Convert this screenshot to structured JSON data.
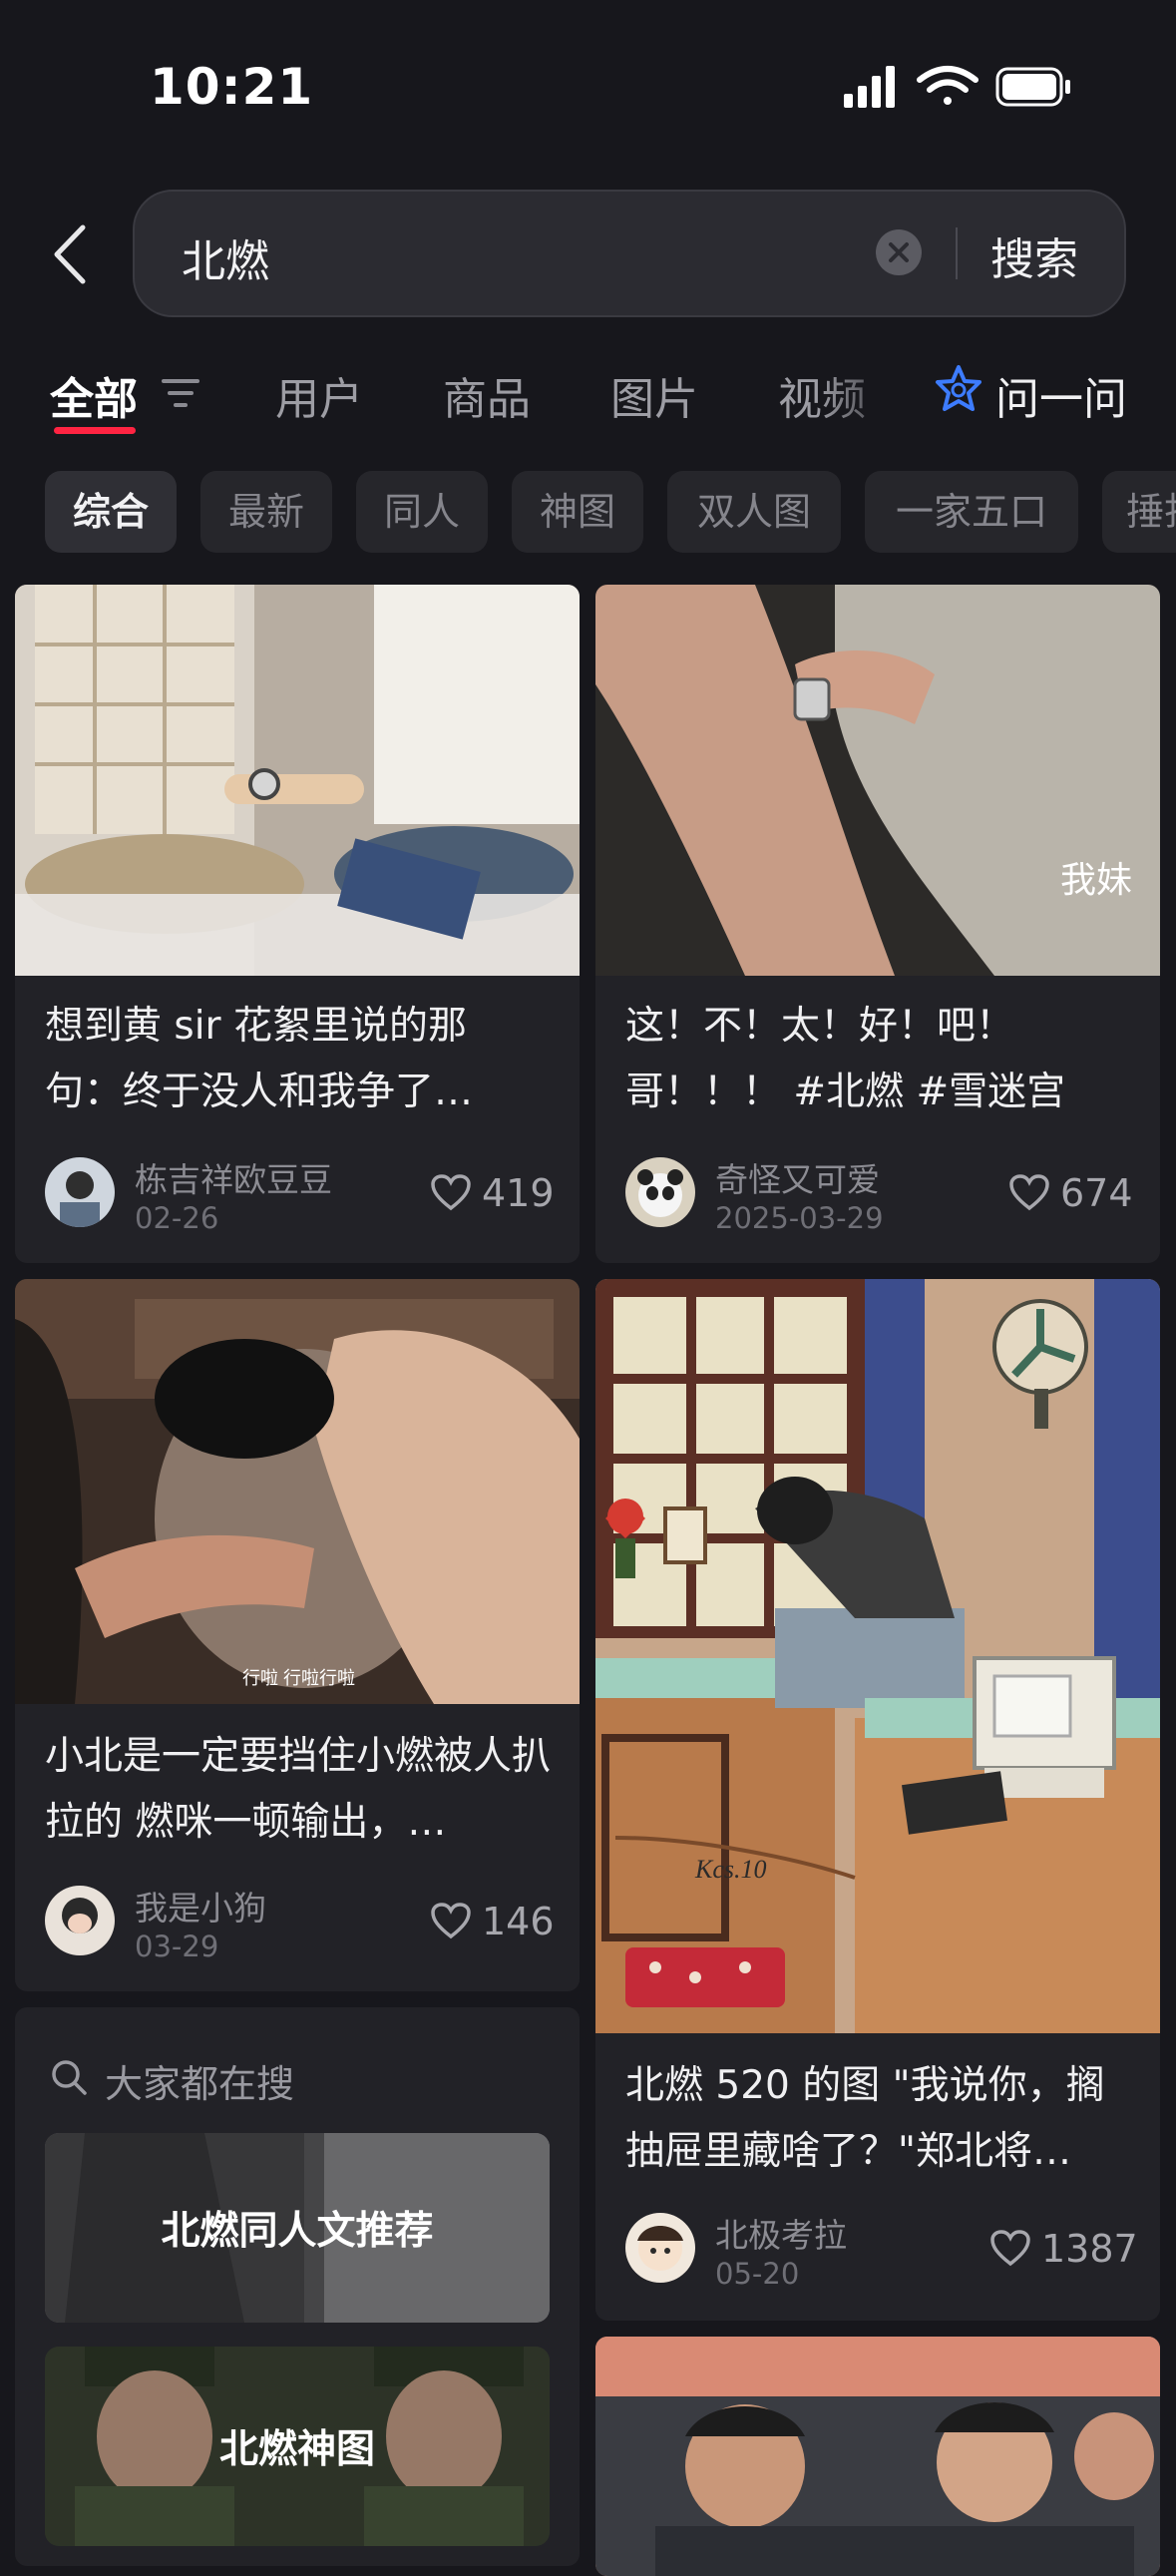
{
  "status": {
    "time": "10:21"
  },
  "search": {
    "query": "北燃",
    "submit_label": "搜索"
  },
  "tabs": [
    {
      "label": "全部"
    },
    {
      "label": "用户"
    },
    {
      "label": "商品"
    },
    {
      "label": "图片"
    },
    {
      "label": "视频"
    },
    {
      "label": "问一问"
    }
  ],
  "chips": [
    {
      "label": "综合"
    },
    {
      "label": "最新"
    },
    {
      "label": "同人"
    },
    {
      "label": "神图"
    },
    {
      "label": "双人图"
    },
    {
      "label": "一家五口"
    },
    {
      "label": "捶打"
    }
  ],
  "posts": [
    {
      "title": "想到黄 sir 花絮里说的那句：终于没人和我争了…",
      "author": "栋吉祥欧豆豆",
      "date": "02-26",
      "likes": "419"
    },
    {
      "title": "这！不！太！好！吧！哥！！！ #北燃 #雪迷宫",
      "image_caption": "我妹",
      "author": "奇怪又可爱",
      "date": "2025-03-29",
      "likes": "674"
    },
    {
      "title": "小北是一定要挡住小燃被人扒拉的 燃咪一顿输出，…",
      "image_caption": "行啦 行啦行啦",
      "author": "我是小狗",
      "date": "03-29",
      "likes": "146"
    },
    {
      "title": "北燃 520 的图 \"我说你，搁抽屉里藏啥了？\"郑北将…",
      "image_caption": "Kcs.10",
      "author": "北极考拉",
      "date": "05-20",
      "likes": "1387"
    }
  ],
  "suggestions": {
    "label": "大家都在搜",
    "items": [
      {
        "label": "北燃同人文推荐"
      },
      {
        "label": "北燃神图"
      }
    ]
  },
  "colors": {
    "accent": "#ff2442",
    "background": "#17171c",
    "card": "#222227",
    "ask_blue": "#3d7cff"
  }
}
